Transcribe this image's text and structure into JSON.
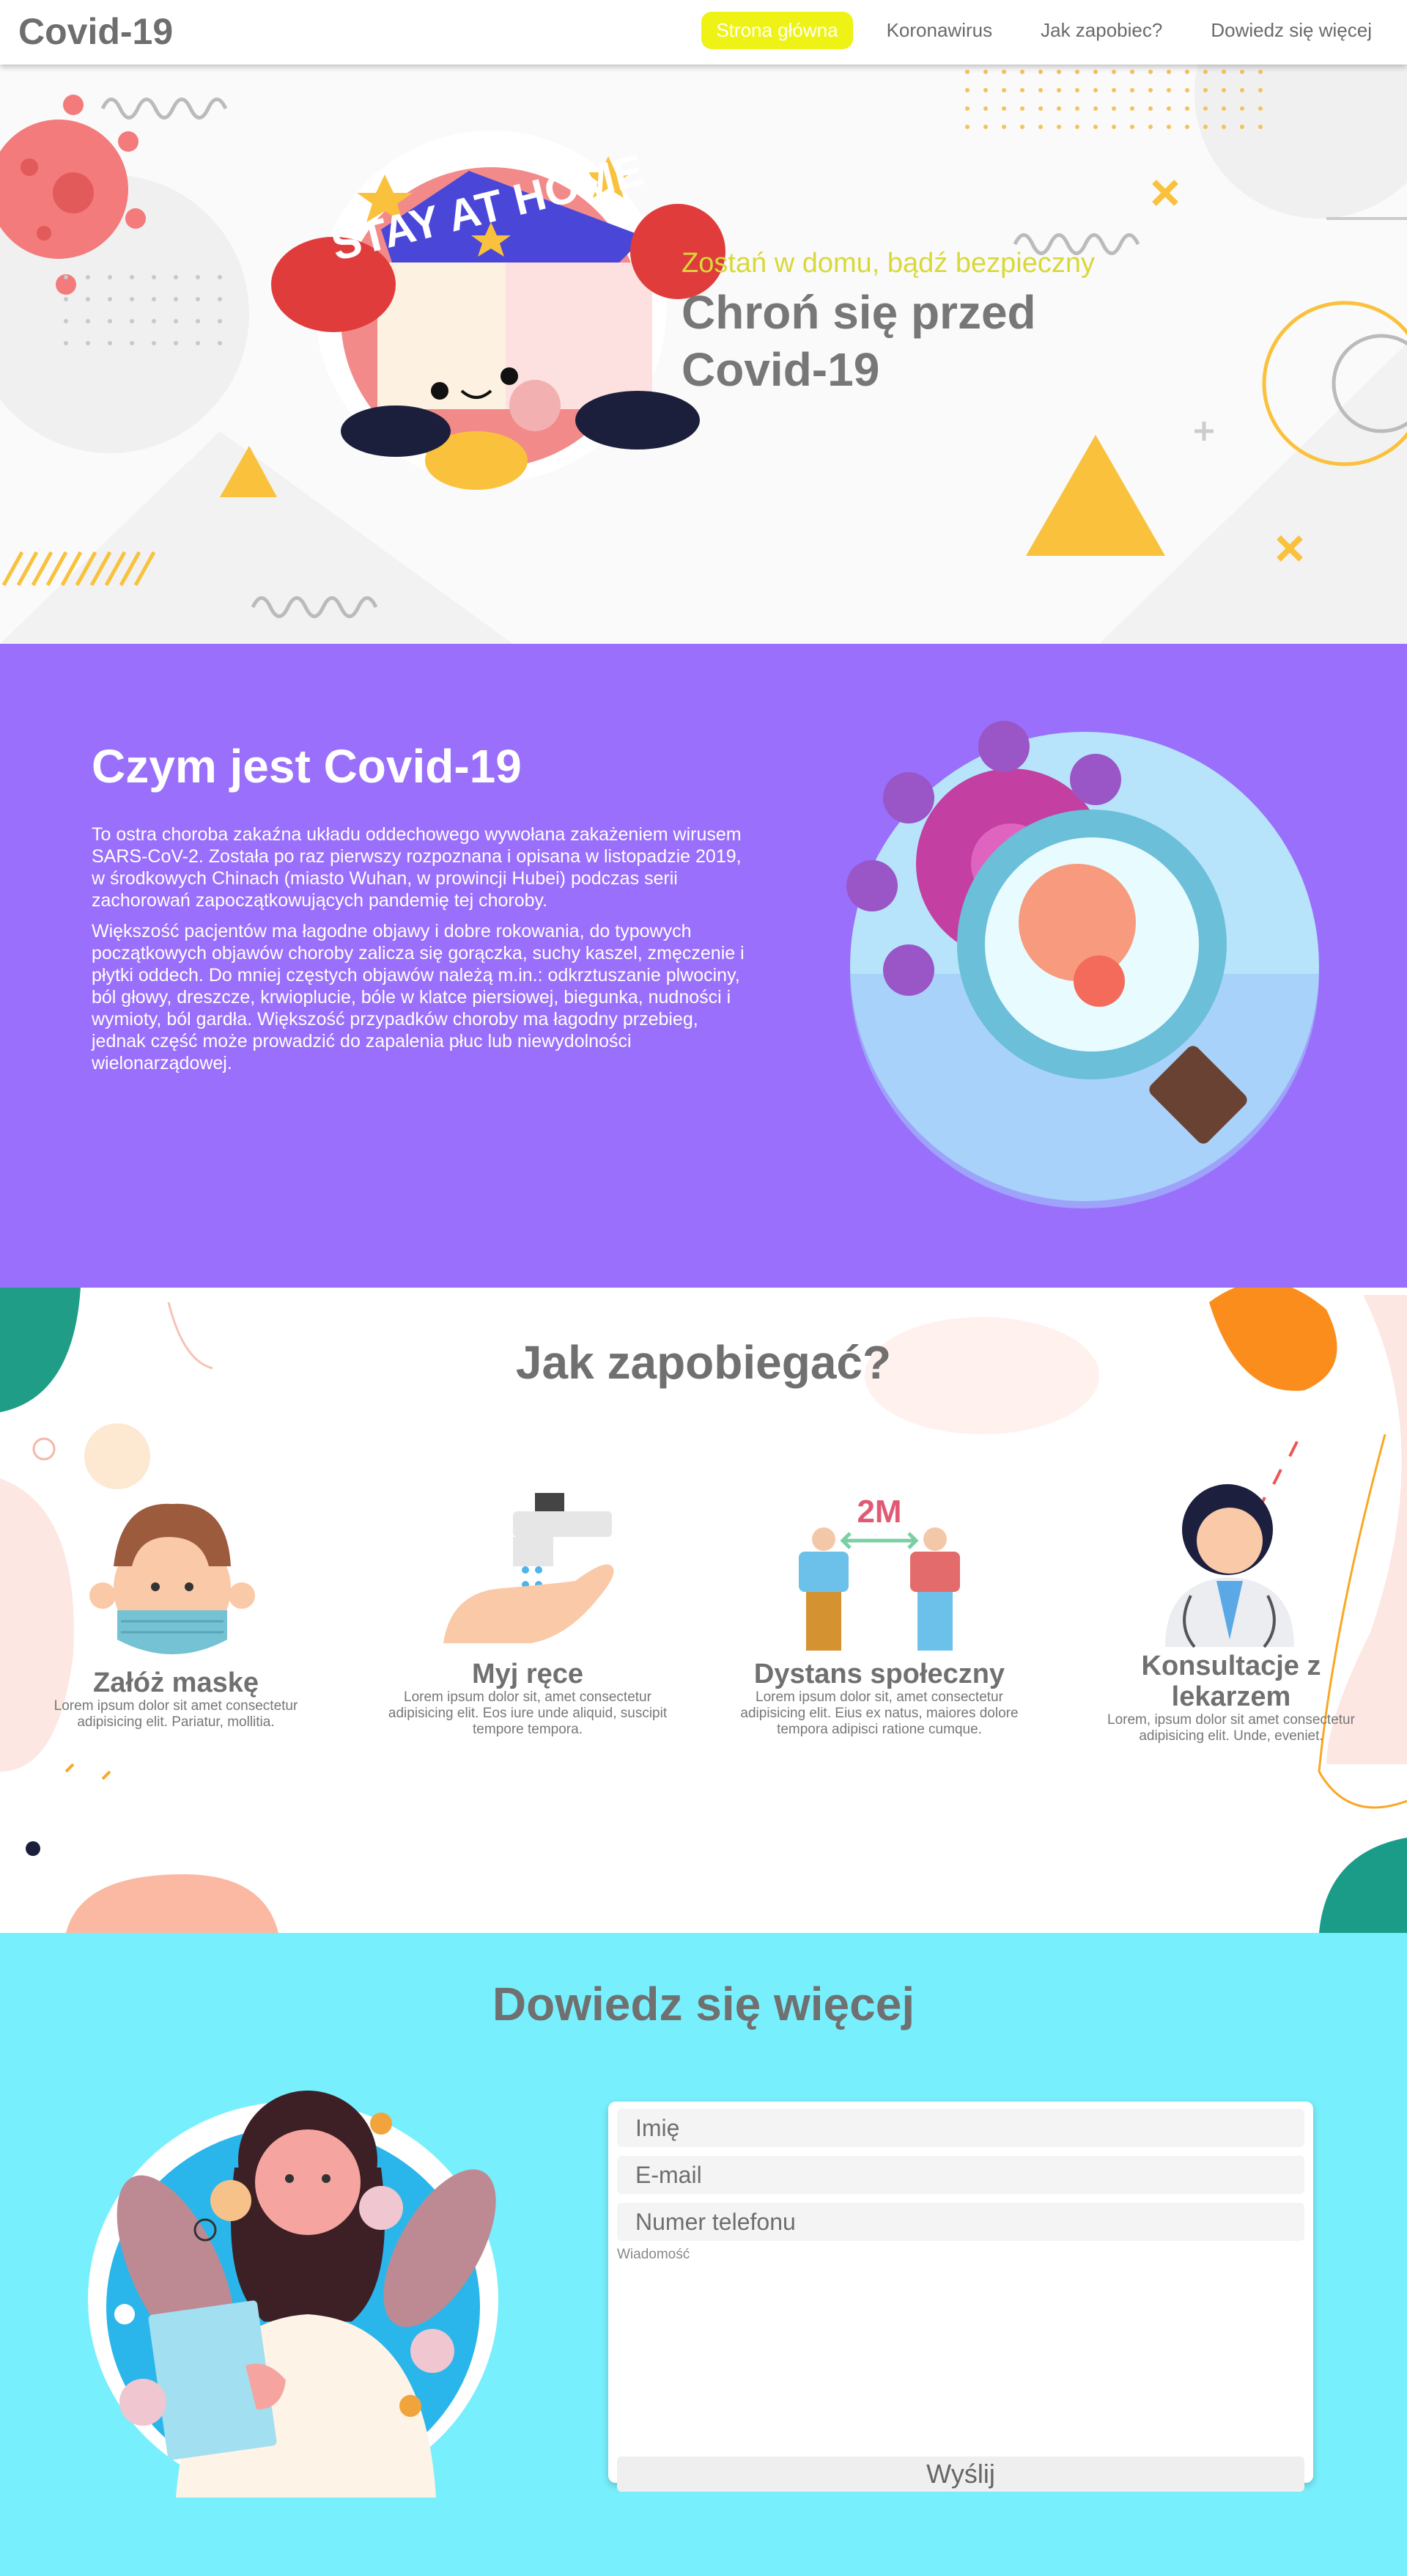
{
  "nav": {
    "logo": "Covid-19",
    "links": [
      "Strona główna",
      "Koronawirus",
      "Jak zapobiec?",
      "Dowiedz się więcej"
    ],
    "active_index": 0
  },
  "hero": {
    "subtitle": "Zostań w domu, bądź bezpieczny",
    "title_line1": "Chroń się przed",
    "title_line2": "Covid-19",
    "badge_text": "STAY AT HOME"
  },
  "about": {
    "title": "Czym jest Covid-19",
    "paragraph1": "To ostra choroba zakaźna układu oddechowego wywołana zakażeniem wirusem SARS-CoV-2. Została po raz pierwszy rozpoznana i opisana w listopadzie 2019, w środkowych Chinach (miasto Wuhan, w prowincji Hubei) podczas serii zachorowań zapoczątkowujących pandemię tej choroby.",
    "paragraph2": "Większość pacjentów ma łagodne objawy i dobre rokowania, do typowych początkowych objawów choroby zalicza się gorączka, suchy kaszel, zmęczenie i płytki oddech. Do mniej częstych objawów należą m.in.: odkrztuszanie plwociny, ból głowy, dreszcze, krwioplucie, bóle w klatce piersiowej, biegunka, nudności i wymioty, ból gardła. Większość przypadków choroby ma łagodny przebieg, jednak część może prowadzić do zapalenia płuc lub niewydolności wielonarządowej."
  },
  "prevent": {
    "title": "Jak zapobiegać?",
    "cards": [
      {
        "title": "Załóż maskę",
        "text": "Lorem ipsum dolor sit amet consectetur adipisicing elit. Pariatur, mollitia."
      },
      {
        "title": "Myj ręce",
        "text": "Lorem ipsum dolor sit, amet consectetur adipisicing elit. Eos iure unde aliquid, suscipit tempore tempora."
      },
      {
        "title": "Dystans społeczny",
        "text": "Lorem ipsum dolor sit, amet consectetur adipisicing elit. Eius ex natus, maiores dolore tempora adipisci ratione cumque."
      },
      {
        "title": "Konsultacje z lekarzem",
        "text": "Lorem, ipsum dolor sit amet consectetur adipisicing elit. Unde, eveniet."
      }
    ],
    "distance_label": "2M"
  },
  "more": {
    "title": "Dowiedz się więcej",
    "form": {
      "name_placeholder": "Imię",
      "email_placeholder": "E-mail",
      "phone_placeholder": "Numer telefonu",
      "message_label": "Wiadomość",
      "submit_label": "Wyślij"
    }
  },
  "colors": {
    "active_nav": "#eef215",
    "about_bg": "#9a6ffb",
    "more_bg": "#78effc",
    "hero_subtitle": "#d9d83a"
  }
}
